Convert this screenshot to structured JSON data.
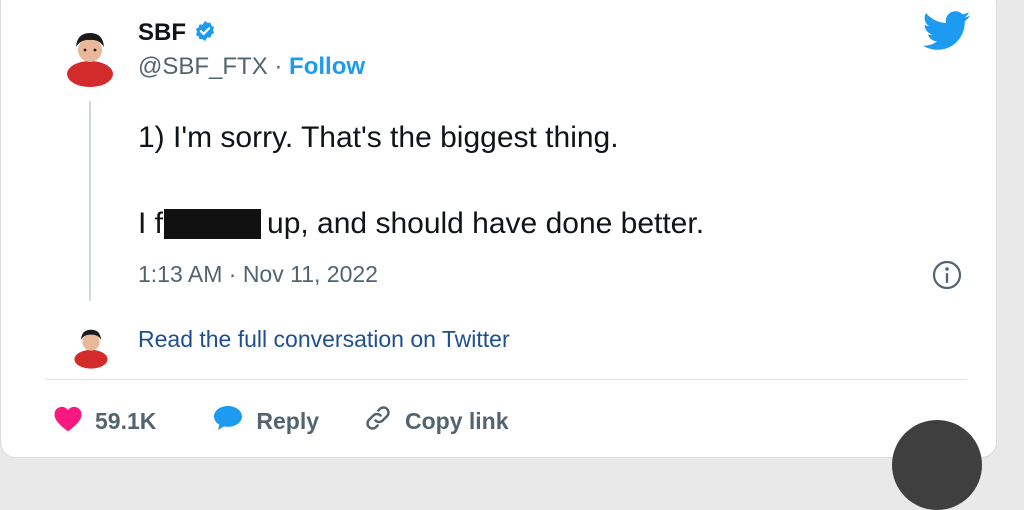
{
  "author": {
    "name": "SBF",
    "handle": "@SBF_FTX",
    "separator": " · ",
    "follow_label": "Follow"
  },
  "tweet": {
    "line1": "1) I'm sorry.  That's the biggest thing.",
    "line2_prefix": "I f",
    "line2_suffix": "up, and should have done better.",
    "timestamp": "1:13 AM · Nov 11, 2022"
  },
  "read_full_link": "Read the full conversation on Twitter",
  "actions": {
    "likes": "59.1K",
    "reply_label": "Reply",
    "copy_link_label": "Copy link"
  },
  "colors": {
    "twitter_blue": "#1d9bf0",
    "like_red": "#f91880",
    "verified_blue": "#1d9bf0",
    "reply_blue": "#1d9bf0"
  },
  "icons": [
    "verified-badge-icon",
    "twitter-bird-icon",
    "info-icon",
    "heart-icon",
    "reply-bubble-icon",
    "link-icon"
  ]
}
